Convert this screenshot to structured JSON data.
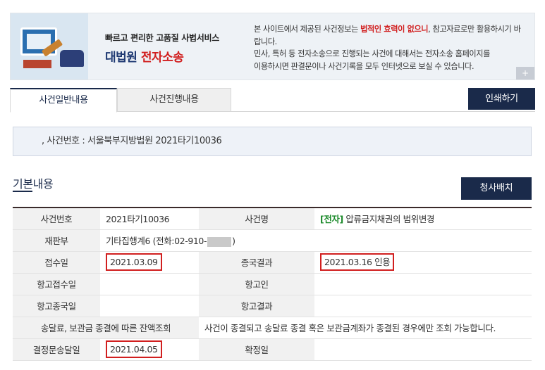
{
  "banner": {
    "subtitle": "빠르고 편리한 고품질 사법서비스",
    "brand_main": "대법원",
    "brand_accent": "전자소송",
    "notice": {
      "pre": "본 사이트에서 제공된 사건정보는 ",
      "warn": "법적인 효력이 없으니",
      "post": ", 참고자료로만 활용하시기 바랍니다.",
      "line3": "민사, 특허 등 전자소송으로 진행되는 사건에 대해서는 전자소송 홈페이지를",
      "line4": "이용하시면 판결문이나 사건기록을 모두 인터넷으로 보실 수 있습니다."
    },
    "plus": "+"
  },
  "tabs": [
    "사건일반내용",
    "사건진행내용"
  ],
  "print_label": "인쇄하기",
  "case_line": ", 사건번호 : 서울북부지방법원 2021타기10036",
  "section_title": "기본내용",
  "secretary_label": "청사배치",
  "table": {
    "case_no_label": "사건번호",
    "case_no": "2021타기10036",
    "case_name_label": "사건명",
    "case_name_tag": "[전자]",
    "case_name": " 압류금지채권의 범위변경",
    "court_dept_label": "재판부",
    "court_dept_pre": "기타집행계6 (전화:02-910-",
    "court_dept_post": ")",
    "received_label": "접수일",
    "received": "2021.03.09",
    "final_result_label": "종국결과",
    "final_result": "2021.03.16 인용",
    "appeal_recv_label": "항고접수일",
    "appeal_recv": "",
    "appellant_label": "항고인",
    "appellant": "",
    "appeal_final_label": "항고종국일",
    "appeal_final": "",
    "appeal_result_label": "항고결과",
    "appeal_result": "",
    "balance_label": "송달료, 보관금 종결에 따른 잔액조회",
    "balance_note": "사건이 종결되고 송달료 종결 혹은 보관금계좌가 종결된 경우에만 조회 가능합니다.",
    "decision_sent_label": "결정문송달일",
    "decision_sent": "2021.04.05",
    "confirmed_label": "확정일",
    "confirmed": ""
  },
  "colors": {
    "navy": "#1a2a4a",
    "highlight_red": "#d11f1f",
    "tag_green": "#1b8a2a"
  }
}
